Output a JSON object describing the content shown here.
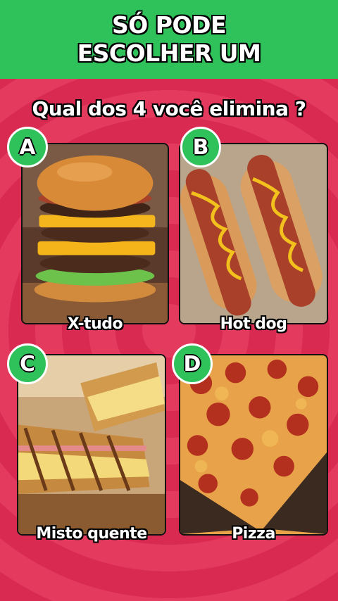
{
  "header": {
    "line1": "SÓ PODE",
    "line2": "ESCOLHER UM"
  },
  "question": "Qual dos 4 você elimina ?",
  "options": [
    {
      "letter": "A",
      "label": "X-tudo",
      "image": "burger-image"
    },
    {
      "letter": "B",
      "label": "Hot dog",
      "image": "hotdog-image"
    },
    {
      "letter": "C",
      "label": "Misto quente",
      "image": "grilled-sandwich-image"
    },
    {
      "letter": "D",
      "label": "Pizza",
      "image": "pepperoni-pizza-image"
    }
  ],
  "colors": {
    "background": "#e8395f",
    "banner": "#2fc25a",
    "badge": "#2fc25a",
    "text": "#ffffff",
    "outline": "#000000"
  }
}
